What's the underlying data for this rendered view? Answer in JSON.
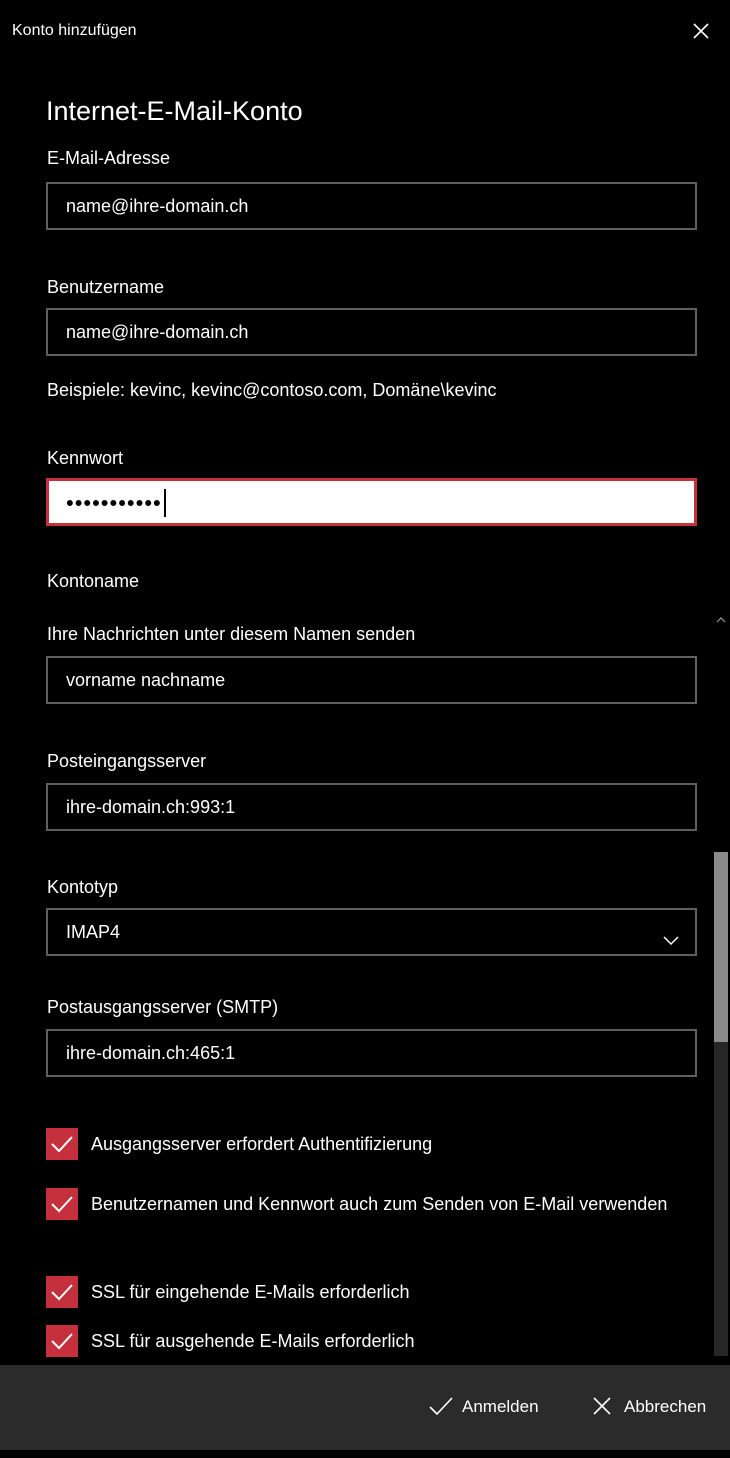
{
  "window": {
    "title": "Konto hinzufügen"
  },
  "heading": "Internet-E-Mail-Konto",
  "email": {
    "label": "E-Mail-Adresse",
    "value": "name@ihre-domain.ch"
  },
  "username": {
    "label": "Benutzername",
    "value": "name@ihre-domain.ch",
    "hint": "Beispiele: kevinc, kevinc@contoso.com, Domäne\\kevinc"
  },
  "password": {
    "label": "Kennwort",
    "masked_value": "•••••••••••"
  },
  "account_name": {
    "label": "Kontoname"
  },
  "display_name": {
    "label": "Ihre Nachrichten unter diesem Namen senden",
    "value": "vorname nachname"
  },
  "incoming_server": {
    "label": "Posteingangsserver",
    "value": "ihre-domain.ch:993:1"
  },
  "account_type": {
    "label": "Kontotyp",
    "selected": "IMAP4"
  },
  "outgoing_server": {
    "label": "Postausgangsserver (SMTP)",
    "value": "ihre-domain.ch:465:1"
  },
  "options": [
    {
      "label": "Ausgangsserver erfordert Authentifizierung",
      "checked": true
    },
    {
      "label": "Benutzernamen und Kennwort auch zum Senden von E-Mail verwenden",
      "checked": true
    },
    {
      "label": "SSL für eingehende E-Mails erforderlich",
      "checked": true
    },
    {
      "label": "SSL für ausgehende E-Mails erforderlich",
      "checked": true
    }
  ],
  "footer": {
    "signin_label": "Anmelden",
    "cancel_label": "Abbrechen"
  },
  "colors": {
    "accent": "#c4303c",
    "background": "#000000",
    "footer_bg": "#2b2b2b",
    "field_border": "#5f5f5f"
  },
  "icons": {
    "close": "close-icon",
    "dropdown": "chevron-down-icon",
    "check": "checkmark-icon",
    "signin": "checkmark-icon",
    "cancel": "close-icon"
  }
}
